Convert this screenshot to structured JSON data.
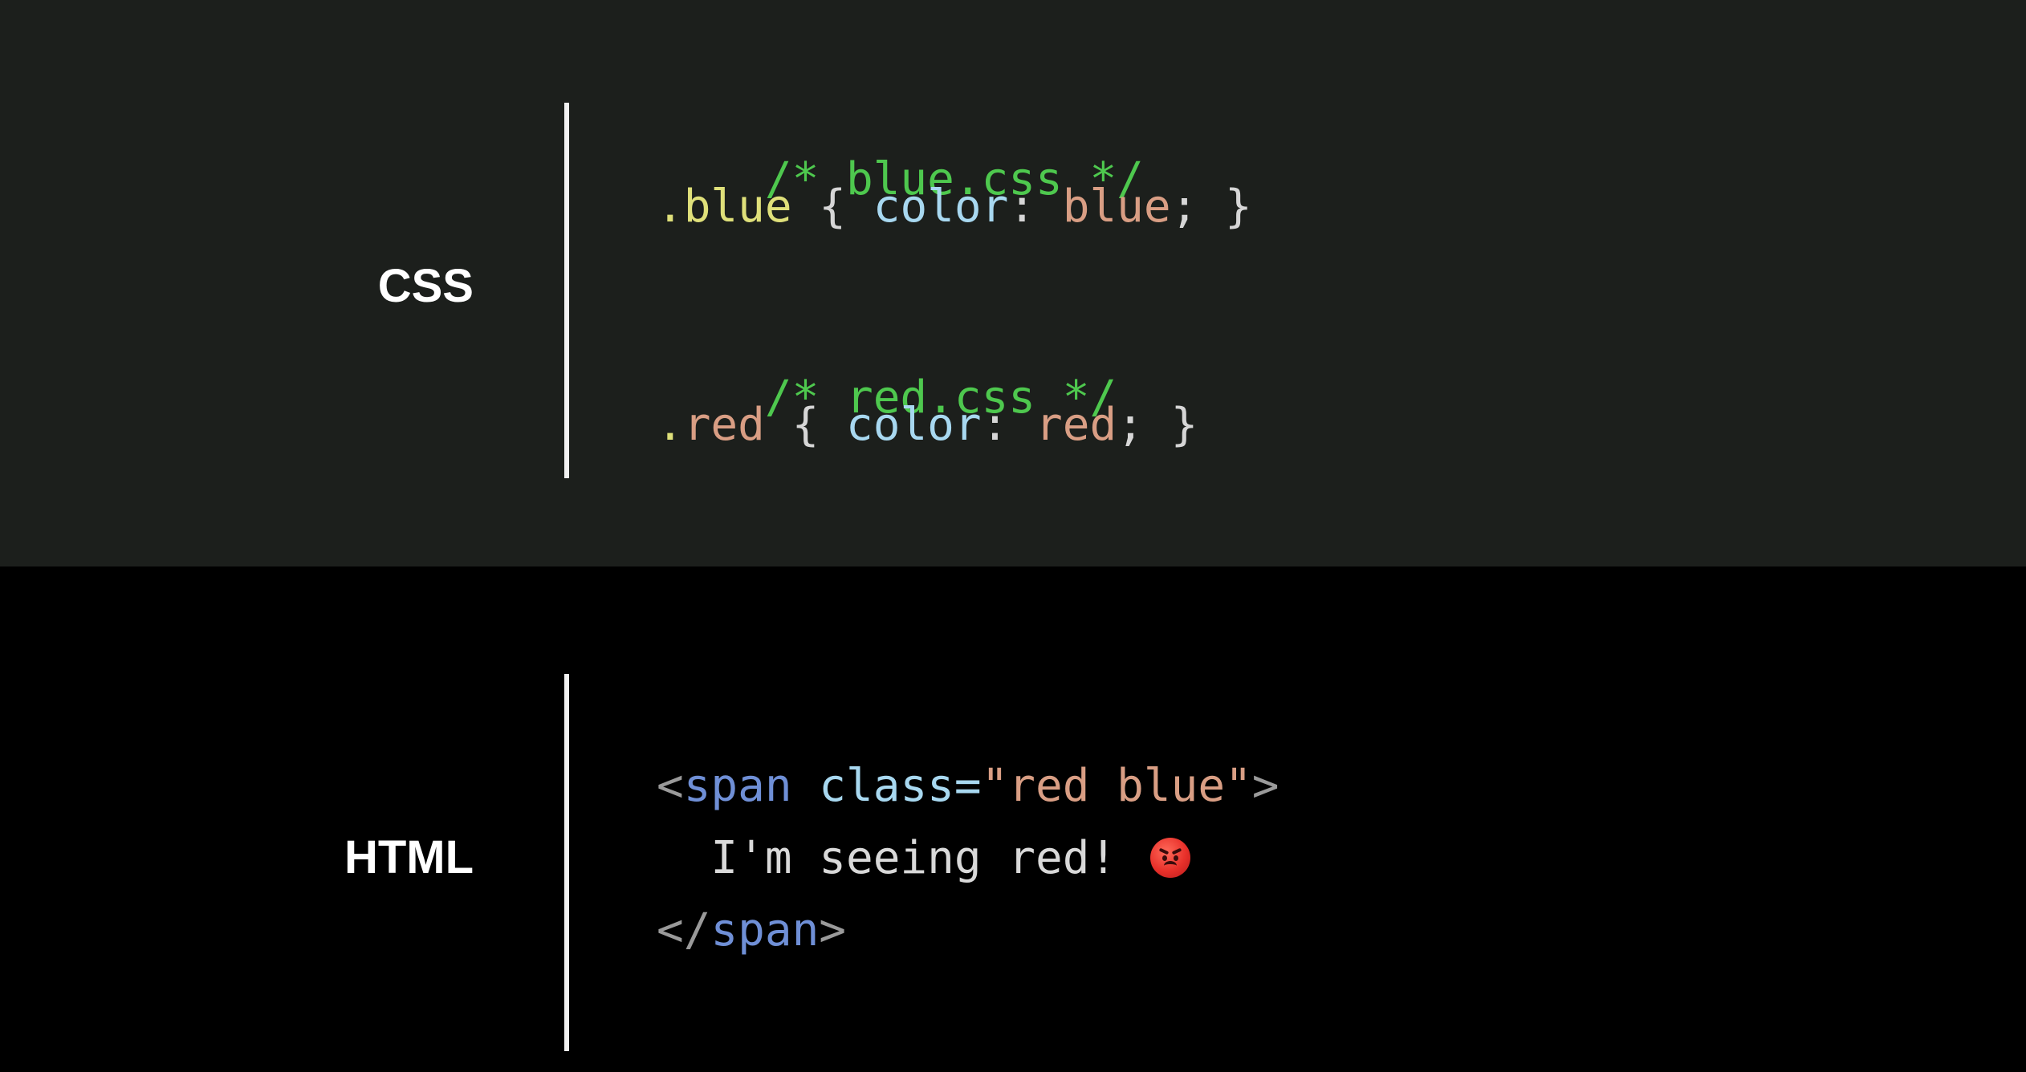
{
  "css_section": {
    "label": "CSS",
    "lines": [
      {
        "comment": "/* blue.css */"
      },
      {
        "dot": ".",
        "selector": "blue",
        "open": " { ",
        "property": "color",
        "colon": ": ",
        "value": "blue",
        "close": "; }"
      },
      {
        "comment": "/* red.css */"
      },
      {
        "dot": ".",
        "selector": "red",
        "open": " { ",
        "property": "color",
        "colon": ": ",
        "value": "red",
        "close": "; }"
      }
    ]
  },
  "html_section": {
    "label": "HTML",
    "open_tag": {
      "lt": "<",
      "tag": "span",
      "space": " ",
      "attr": "class",
      "eq": "=",
      "value": "\"red blue\"",
      "gt": ">"
    },
    "text": "  I'm seeing red! ",
    "emoji": "angry-face-emoji",
    "close_tag": {
      "lt": "</",
      "tag": "span",
      "gt": ">"
    }
  },
  "colors": {
    "css_panel_bg": "#1c1f1c",
    "html_panel_bg": "#000000",
    "comment": "#4ec84e",
    "selector": "#dfe07a",
    "property": "#a8d8f0",
    "value": "#d99e84",
    "tag": "#6f8fd6",
    "divider": "#f2f2f2"
  }
}
